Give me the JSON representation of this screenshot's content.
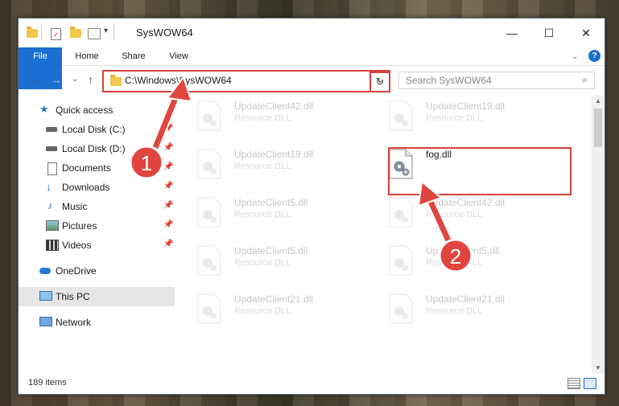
{
  "window": {
    "title": "SysWOW64",
    "minimize_glyph": "—",
    "maximize_glyph": "☐",
    "close_glyph": "✕"
  },
  "ribbon": {
    "tabs": [
      "File",
      "Home",
      "Share",
      "View"
    ],
    "collapse_glyph": "⌄",
    "help_glyph": "?"
  },
  "address": {
    "path": "C:\\Windows\\SysWOW64",
    "dropdown_glyph": "⌄",
    "refresh_glyph": "↻",
    "search_placeholder": "Search SysWOW64",
    "search_icon_glyph": "⌕"
  },
  "nav_glyphs": {
    "back": "←",
    "forward": "→",
    "recent": "⌄",
    "up": "↑"
  },
  "navpane": {
    "items": [
      {
        "label": "Quick access"
      },
      {
        "label": "Local Disk (C:)"
      },
      {
        "label": "Local Disk (D:)"
      },
      {
        "label": "Documents"
      },
      {
        "label": "Downloads"
      },
      {
        "label": "Music"
      },
      {
        "label": "Pictures"
      },
      {
        "label": "Videos"
      },
      {
        "label": "OneDrive"
      },
      {
        "label": "This PC"
      },
      {
        "label": "Network"
      }
    ]
  },
  "files": [
    {
      "name": "UpdateClient42.dll",
      "type": "Resource DLL"
    },
    {
      "name": "UpdateClient19.dll",
      "type": "Resource DLL"
    },
    {
      "name": "UpdateClient19.dll",
      "type": "Resource DLL"
    },
    {
      "name": "fog.dll",
      "type": ""
    },
    {
      "name": "UpdateClient5.dll",
      "type": "Resource DLL"
    },
    {
      "name": "UpdateClient42.dll",
      "type": "Resource DLL"
    },
    {
      "name": "UpdateClient5.dll",
      "type": "Resource DLL"
    },
    {
      "name": "UpdateClient5.dll",
      "type": "Resource DLL"
    },
    {
      "name": "UpdateClient21.dll",
      "type": "Resource DLL"
    },
    {
      "name": "UpdateClient21.dll",
      "type": "Resource DLL"
    }
  ],
  "status": {
    "items": "189 items"
  },
  "annotations": {
    "step1": "1",
    "step2": "2"
  },
  "colors": {
    "accent": "#1a6fd0",
    "highlight": "#d9423a",
    "folder": "#f3c64c"
  }
}
